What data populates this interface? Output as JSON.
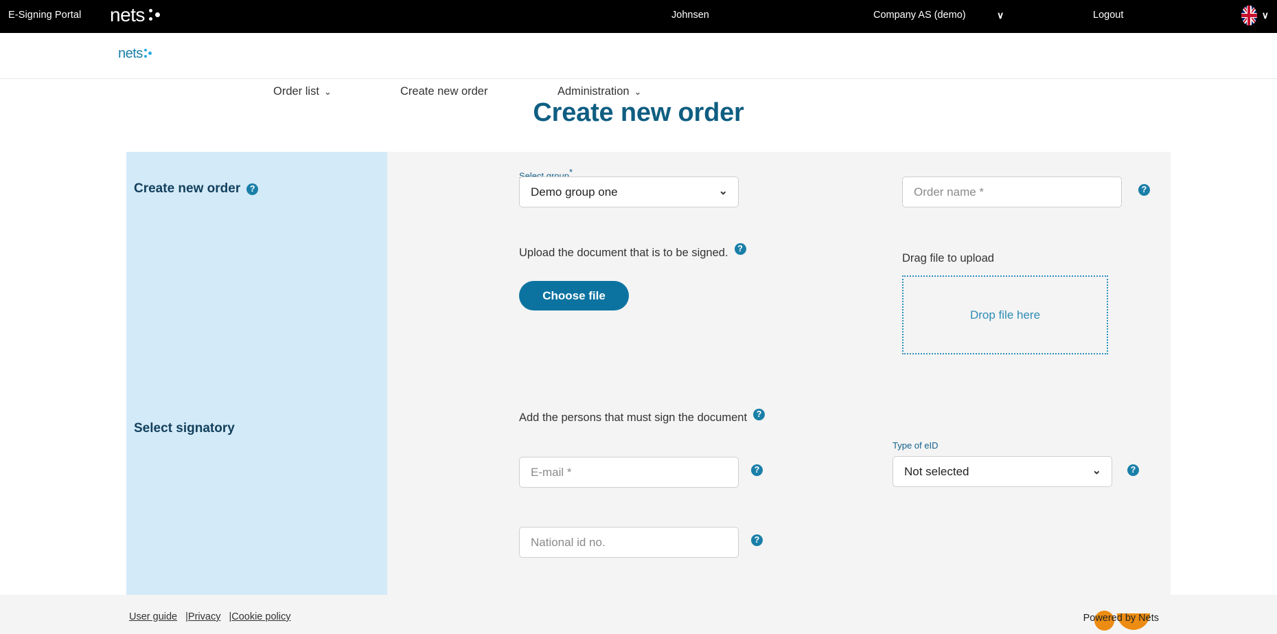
{
  "topbar": {
    "portal_title": "E-Signing Portal",
    "brand": "nets",
    "user_name": "Johnsen",
    "company": "Company AS (demo)",
    "company_caret": "∨",
    "logout": "Logout",
    "language_flag": "uk-flag-icon",
    "language_caret": "∨"
  },
  "nav": {
    "brand": "nets",
    "items": [
      {
        "label": "Order list",
        "caret": "⌄",
        "has_caret": true
      },
      {
        "label": "Create new order",
        "caret": "",
        "has_caret": false
      },
      {
        "label": "Administration",
        "caret": "⌄",
        "has_caret": true
      }
    ]
  },
  "page": {
    "title": "Create new order"
  },
  "sidebar": {
    "sections": [
      {
        "heading": "Create new order",
        "help": "?"
      },
      {
        "heading": "Select signatory",
        "help": "?"
      }
    ]
  },
  "form": {
    "select_group": {
      "label": "Select group",
      "required_mark": "*",
      "value": "Demo group one",
      "chevron": "⌄"
    },
    "order_name": {
      "placeholder": "Order name *",
      "value": "",
      "help": "?"
    },
    "upload": {
      "text": "Upload the document that is to be signed.",
      "help": "?",
      "button_label": "Choose file"
    },
    "drag": {
      "label": "Drag file to upload",
      "dropzone_text": "Drop file here"
    },
    "signatory": {
      "intro": "Add the persons that must sign the document",
      "intro_help": "?",
      "email": {
        "placeholder": "E-mail *",
        "value": "",
        "help": "?"
      },
      "national_id": {
        "placeholder": "National id no.",
        "value": "",
        "help": "?"
      },
      "eid": {
        "label": "Type of eID",
        "value": "Not selected",
        "chevron": "⌄",
        "help": "?"
      }
    }
  },
  "footer": {
    "links": [
      {
        "label": "User guide",
        "sep": ""
      },
      {
        "label": "Privacy",
        "sep": "|"
      },
      {
        "label": "Cookie policy",
        "sep": "|"
      }
    ],
    "powered_by": "Powered by Nets"
  },
  "colors": {
    "topbar_bg": "#000000",
    "brand_blue": "#1c7fa8",
    "accent_teal": "#0c73a0",
    "title_blue": "#0f5e82",
    "sidebar_bg": "#d3eaf8",
    "panel_bg": "#f4f4f4",
    "orange": "#ec8c12"
  }
}
